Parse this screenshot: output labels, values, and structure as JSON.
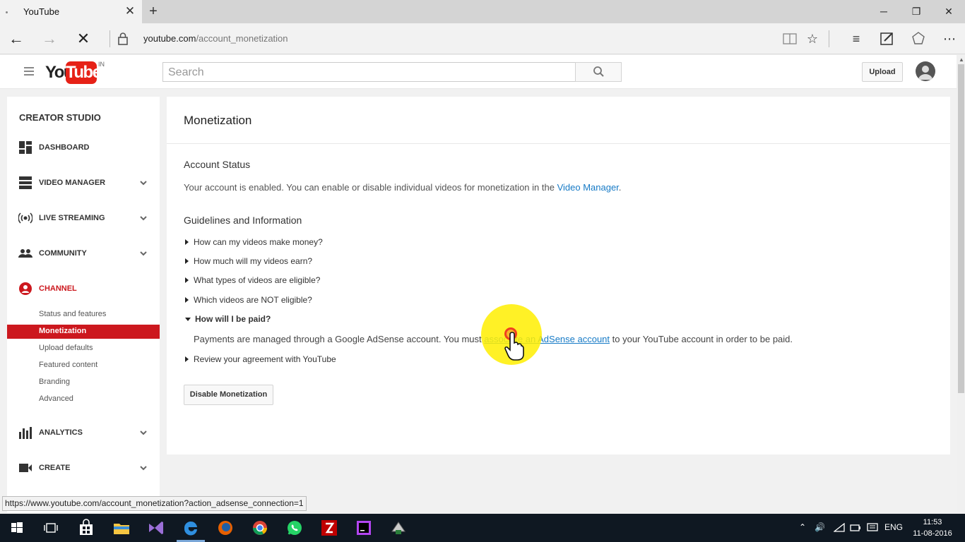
{
  "browser": {
    "tab_title": "YouTube",
    "url_domain": "youtube.com",
    "url_path": "/account_monetization",
    "status_url": "https://www.youtube.com/account_monetization?action_adsense_connection=1"
  },
  "header": {
    "logo_you": "You",
    "logo_tube": "Tube",
    "logo_region": "IN",
    "search_placeholder": "Search",
    "upload_label": "Upload"
  },
  "sidebar": {
    "title": "CREATOR STUDIO",
    "items": [
      {
        "label": "DASHBOARD"
      },
      {
        "label": "VIDEO MANAGER"
      },
      {
        "label": "LIVE STREAMING"
      },
      {
        "label": "COMMUNITY"
      },
      {
        "label": "CHANNEL"
      },
      {
        "label": "ANALYTICS"
      },
      {
        "label": "CREATE"
      }
    ],
    "channel_sub": [
      {
        "label": "Status and features"
      },
      {
        "label": "Monetization"
      },
      {
        "label": "Upload defaults"
      },
      {
        "label": "Featured content"
      },
      {
        "label": "Branding"
      },
      {
        "label": "Advanced"
      }
    ]
  },
  "main": {
    "title": "Monetization",
    "account_status_heading": "Account Status",
    "status_text": "Your account is enabled. You can enable or disable individual videos for monetization in the ",
    "status_link": "Video Manager",
    "status_end": ".",
    "guidelines_heading": "Guidelines and Information",
    "faqs": [
      {
        "label": "How can my videos make money?"
      },
      {
        "label": "How much will my videos earn?"
      },
      {
        "label": "What types of videos are eligible?"
      },
      {
        "label": "Which videos are NOT eligible?"
      },
      {
        "label": "How will I be paid?"
      },
      {
        "label": "Review your agreement with YouTube"
      }
    ],
    "answer_pre": "Payments are managed through a Google AdSense account. You must ",
    "answer_link": "associate an AdSense account",
    "answer_post": " to your YouTube account in order to be paid.",
    "disable_button": "Disable Monetization"
  },
  "taskbar": {
    "language": "ENG",
    "time": "11:53",
    "date": "11-08-2016"
  },
  "colors": {
    "youtube_red": "#e62117",
    "active_red": "#cc181e",
    "link_blue": "#167ac6",
    "taskbar": "#0f1822"
  }
}
